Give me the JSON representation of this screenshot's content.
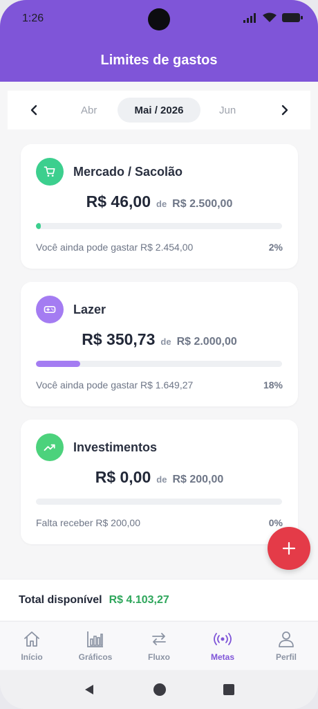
{
  "status": {
    "time": "1:26"
  },
  "header": {
    "title": "Limites de gastos"
  },
  "month_selector": {
    "previous": "Abr",
    "current": "Mai / 2026",
    "next": "Jun"
  },
  "cards": [
    {
      "title": "Mercado / Sacolão",
      "icon": "cart-icon",
      "icon_bg": "#3ccf8e",
      "spent": "R$ 46,00",
      "of": "de",
      "limit": "R$ 2.500,00",
      "progress": 0.02,
      "progress_color": "#3ccf8e",
      "foot_text": "Você ainda pode gastar R$ 2.454,00",
      "percent": "2%"
    },
    {
      "title": "Lazer",
      "icon": "gamepad-icon",
      "icon_bg": "#a47cf2",
      "spent": "R$ 350,73",
      "of": "de",
      "limit": "R$ 2.000,00",
      "progress": 0.18,
      "progress_color": "#a47cf2",
      "foot_text": "Você ainda pode gastar R$ 1.649,27",
      "percent": "18%"
    },
    {
      "title": "Investimentos",
      "icon": "trending-up-icon",
      "icon_bg": "#4cd27c",
      "spent": "R$ 0,00",
      "of": "de",
      "limit": "R$ 200,00",
      "progress": 0,
      "progress_color": "#4cd27c",
      "foot_text": "Falta receber R$ 200,00",
      "percent": "0%"
    }
  ],
  "fab": {
    "icon": "plus-icon",
    "color": "#e43b48"
  },
  "total": {
    "label": "Total disponível",
    "value": "R$ 4.103,27",
    "value_color": "#2ea65b"
  },
  "nav": [
    {
      "label": "Início",
      "icon": "home-icon"
    },
    {
      "label": "Gráficos",
      "icon": "bar-chart-icon"
    },
    {
      "label": "Fluxo",
      "icon": "swap-icon"
    },
    {
      "label": "Metas",
      "icon": "broadcast-icon",
      "active": true
    },
    {
      "label": "Perfil",
      "icon": "user-icon"
    }
  ],
  "colors": {
    "accent": "#7f55d8"
  }
}
